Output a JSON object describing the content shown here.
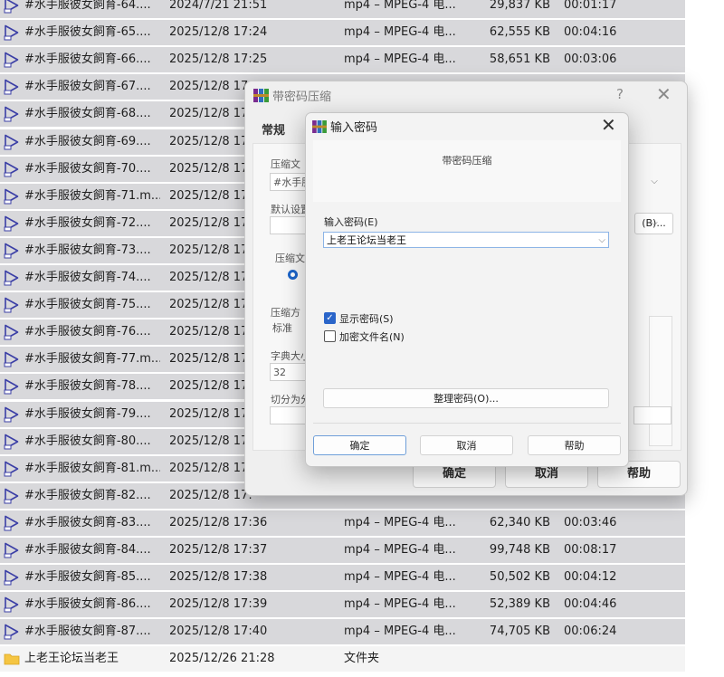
{
  "file_rows": [
    {
      "name": "#水手服彼女飼育-64....",
      "date": "2024/7/21 21:51",
      "type": "mp4 – MPEG-4 电...",
      "size": "29,837 KB",
      "duration": "00:01:17"
    },
    {
      "name": "#水手服彼女飼育-65....",
      "date": "2025/12/8 17:24",
      "type": "mp4 – MPEG-4 电...",
      "size": "62,555 KB",
      "duration": "00:04:16"
    },
    {
      "name": "#水手服彼女飼育-66....",
      "date": "2025/12/8 17:25",
      "type": "mp4 – MPEG-4 电...",
      "size": "58,651 KB",
      "duration": "00:03:06"
    },
    {
      "name": "#水手服彼女飼育-67....",
      "date": "2025/12/8 17:",
      "type": "",
      "size": "",
      "duration": ""
    },
    {
      "name": "#水手服彼女飼育-68....",
      "date": "2025/12/8 17:",
      "type": "",
      "size": "",
      "duration": ""
    },
    {
      "name": "#水手服彼女飼育-69....",
      "date": "2025/12/8 17:",
      "type": "",
      "size": "",
      "duration": ""
    },
    {
      "name": "#水手服彼女飼育-70....",
      "date": "2025/12/8 17:",
      "type": "",
      "size": "",
      "duration": ""
    },
    {
      "name": "#水手服彼女飼育-71.m...",
      "date": "2025/12/8 17:",
      "type": "",
      "size": "",
      "duration": ""
    },
    {
      "name": "#水手服彼女飼育-72....",
      "date": "2025/12/8 17:",
      "type": "",
      "size": "",
      "duration": ""
    },
    {
      "name": "#水手服彼女飼育-73....",
      "date": "2025/12/8 17:",
      "type": "",
      "size": "",
      "duration": ""
    },
    {
      "name": "#水手服彼女飼育-74....",
      "date": "2025/12/8 17:",
      "type": "",
      "size": "",
      "duration": ""
    },
    {
      "name": "#水手服彼女飼育-75....",
      "date": "2025/12/8 17:",
      "type": "",
      "size": "",
      "duration": ""
    },
    {
      "name": "#水手服彼女飼育-76....",
      "date": "2025/12/8 17:",
      "type": "",
      "size": "",
      "duration": ""
    },
    {
      "name": "#水手服彼女飼育-77.m...",
      "date": "2025/12/8 17:",
      "type": "",
      "size": "",
      "duration": ""
    },
    {
      "name": "#水手服彼女飼育-78....",
      "date": "2025/12/8 17:",
      "type": "",
      "size": "",
      "duration": ""
    },
    {
      "name": "#水手服彼女飼育-79....",
      "date": "2025/12/8 17:",
      "type": "",
      "size": "",
      "duration": ""
    },
    {
      "name": "#水手服彼女飼育-80....",
      "date": "2025/12/8 17:",
      "type": "",
      "size": "",
      "duration": ""
    },
    {
      "name": "#水手服彼女飼育-81.m...",
      "date": "2025/12/8 17:",
      "type": "",
      "size": "",
      "duration": ""
    },
    {
      "name": "#水手服彼女飼育-82....",
      "date": "2025/12/8 17:",
      "type": "",
      "size": "",
      "duration": ""
    },
    {
      "name": "#水手服彼女飼育-83....",
      "date": "2025/12/8 17:36",
      "type": "mp4 – MPEG-4 电...",
      "size": "62,340 KB",
      "duration": "00:03:46"
    },
    {
      "name": "#水手服彼女飼育-84....",
      "date": "2025/12/8 17:37",
      "type": "mp4 – MPEG-4 电...",
      "size": "99,748 KB",
      "duration": "00:08:17"
    },
    {
      "name": "#水手服彼女飼育-85....",
      "date": "2025/12/8 17:38",
      "type": "mp4 – MPEG-4 电...",
      "size": "50,502 KB",
      "duration": "00:04:12"
    },
    {
      "name": "#水手服彼女飼育-86....",
      "date": "2025/12/8 17:39",
      "type": "mp4 – MPEG-4 电...",
      "size": "52,389 KB",
      "duration": "00:04:46"
    },
    {
      "name": "#水手服彼女飼育-87....",
      "date": "2025/12/8 17:40",
      "type": "mp4 – MPEG-4 电...",
      "size": "74,705 KB",
      "duration": "00:06:24"
    },
    {
      "name": "上老王论坛当老王",
      "date": "2025/12/26 21:28",
      "type": "文件夹",
      "size": "",
      "duration": "",
      "folder": true
    }
  ],
  "compress_dialog": {
    "title": "带密码压缩",
    "help_symbol": "?",
    "close_symbol": "✕",
    "tab_general": "常规",
    "label_archive_name": "压缩文",
    "archive_name_value": "#水手服",
    "browse_btn": "(B)...",
    "label_default_settings": "默认设置",
    "label_archive_format": "压缩文",
    "label_method": "压缩方",
    "method_value": "标准",
    "label_dict_size": "字典大小",
    "dict_size_value": "32",
    "label_split": "切分为分",
    "ok": "确定",
    "cancel": "取消",
    "help": "帮助"
  },
  "password_dialog": {
    "title": "输入密码",
    "close_symbol": "✕",
    "subtitle": "带密码压缩",
    "password_label": "输入密码(E)",
    "password_value": "上老王论坛当老王",
    "show_password_label": "显示密码(S)",
    "show_password_checked": true,
    "encrypt_names_label": "加密文件名(N)",
    "encrypt_names_checked": false,
    "organize_btn": "整理密码(O)...",
    "ok": "确定",
    "cancel": "取消",
    "help": "帮助"
  },
  "colors": {
    "row_bg": "#d8d8db",
    "accent": "#2a65c9",
    "folder_icon": "#f5c542",
    "video_icon": "#3b3fa6"
  }
}
